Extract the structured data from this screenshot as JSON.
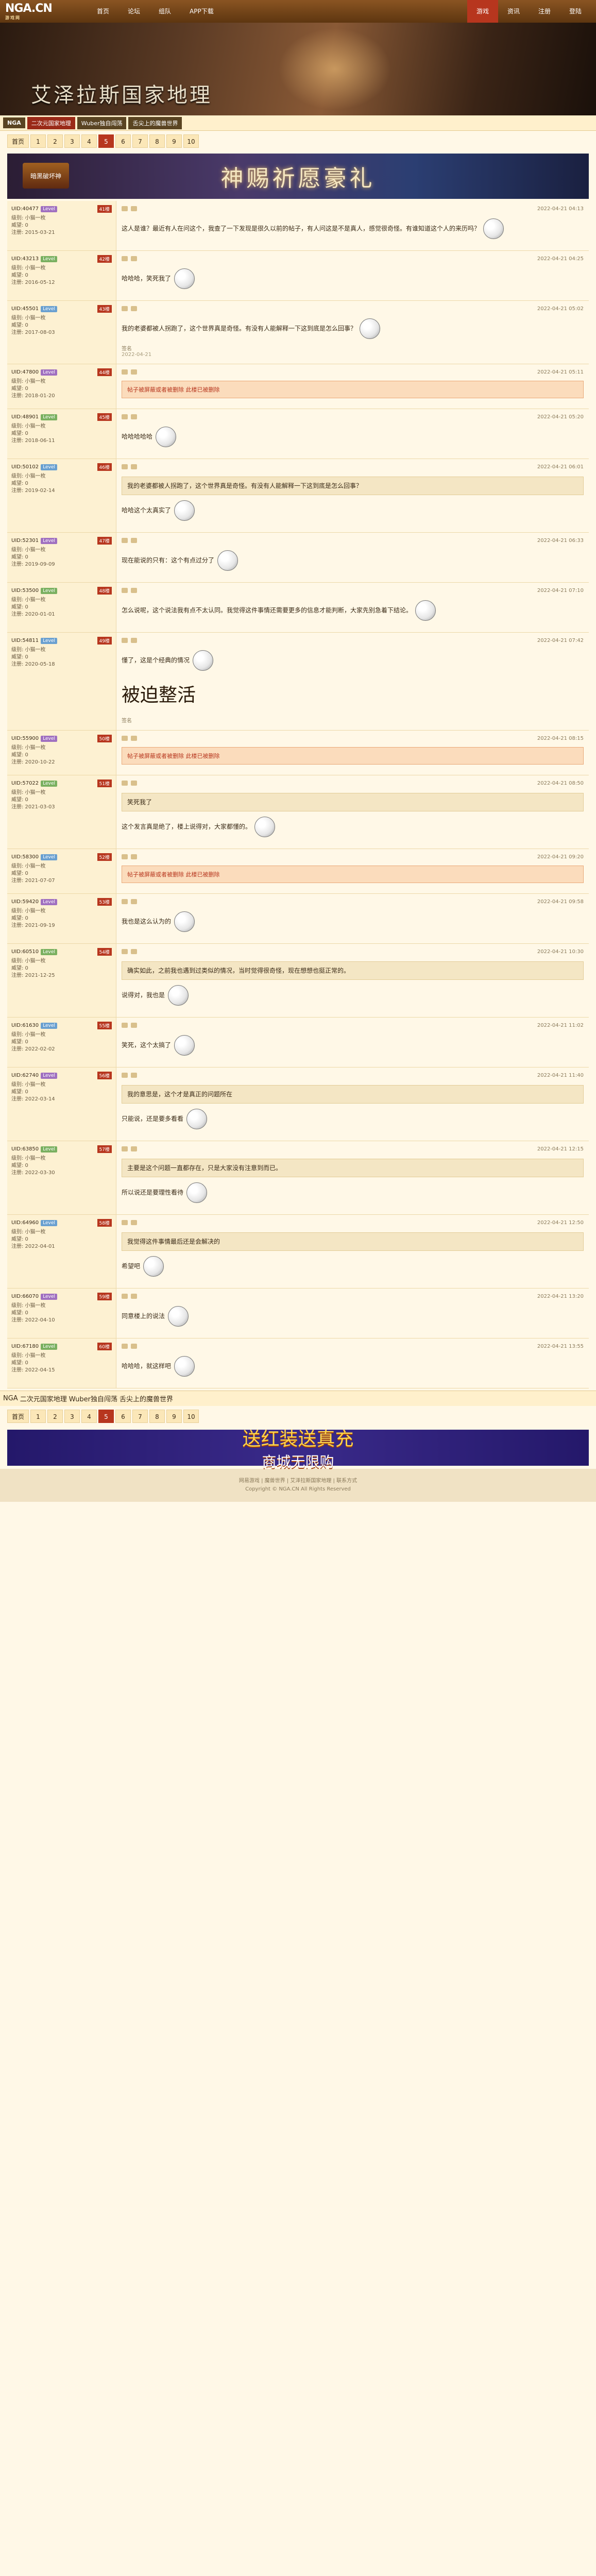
{
  "logo": {
    "main": "NGA.CN",
    "sub": "游戏网"
  },
  "nav": [
    "首页",
    "论坛",
    "组队",
    "APP下载"
  ],
  "nav_right": [
    "游戏",
    "资讯",
    "注册",
    "登陆"
  ],
  "banner_title": "艾泽拉斯国家地理",
  "subnav": {
    "home": "NGA",
    "tags": [
      "二次元国家地理",
      "Wuber独自闯荡",
      "舌尖上的魔兽世界"
    ],
    "home_btn": "论坛"
  },
  "pager": {
    "first": "首页",
    "pages": [
      "1",
      "2",
      "3",
      "4",
      "5",
      "6",
      "7",
      "8",
      "9",
      "10"
    ],
    "current": "5"
  },
  "ad_top": "神赐祈愿豪礼",
  "ad_logo": "暗黑破坏神",
  "posts": [
    {
      "uid": "UID:40477",
      "badge": "Level",
      "meta": [
        "级别: 小猫一枚",
        "威望: 0",
        "注册: 2015-03-21"
      ],
      "floor": "41楼",
      "time": "2022-04-21 04:13",
      "body": "这人是谁？最近有人在问这个，我查了一下发现是很久以前的帖子，有人问这是不是真人，感觉很奇怪。有谁知道这个人的来历吗？"
    },
    {
      "uid": "UID:43213",
      "badge": "Level",
      "meta": [
        "级别: 小猫一枚",
        "威望: 0",
        "注册: 2016-05-12"
      ],
      "floor": "42楼",
      "time": "2022-04-21 04:25",
      "body": "哈哈哈，笑死我了"
    },
    {
      "uid": "UID:45501",
      "badge": "Level",
      "meta": [
        "级别: 小猫一枚",
        "威望: 0",
        "注册: 2017-08-03"
      ],
      "floor": "43楼",
      "time": "2022-04-21 05:02",
      "body": "我的老婆都被人拐跑了，这个世界真是奇怪。有没有人能解释一下这到底是怎么回事？",
      "sig": "签名",
      "sig_time": "2022-04-21"
    },
    {
      "uid": "UID:47800",
      "badge": "Level",
      "meta": [
        "级别: 小猫一枚",
        "威望: 0",
        "注册: 2018-01-20"
      ],
      "floor": "44楼",
      "time": "2022-04-21 05:11",
      "red": "帖子被屏蔽或者被删除 此楼已被删除"
    },
    {
      "uid": "UID:48901",
      "badge": "Level",
      "meta": [
        "级别: 小猫一枚",
        "威望: 0",
        "注册: 2018-06-11"
      ],
      "floor": "45楼",
      "time": "2022-04-21 05:20",
      "body": "哈哈哈哈哈"
    },
    {
      "uid": "UID:50102",
      "badge": "Level",
      "meta": [
        "级别: 小猫一枚",
        "威望: 0",
        "注册: 2019-02-14"
      ],
      "floor": "46楼",
      "time": "2022-04-21 06:01",
      "quote": "我的老婆都被人拐跑了，这个世界真是奇怪。有没有人能解释一下这到底是怎么回事？",
      "body": "哈哈这个太真实了"
    },
    {
      "uid": "UID:52301",
      "badge": "Level",
      "meta": [
        "级别: 小猫一枚",
        "威望: 0",
        "注册: 2019-09-09"
      ],
      "floor": "47楼",
      "time": "2022-04-21 06:33",
      "body": "现在能说的只有：这个有点过分了"
    },
    {
      "uid": "UID:53500",
      "badge": "Level",
      "meta": [
        "级别: 小猫一枚",
        "威望: 0",
        "注册: 2020-01-01"
      ],
      "floor": "48楼",
      "time": "2022-04-21 07:10",
      "body": "怎么说呢，这个说法我有点不太认同。我觉得这件事情还需要更多的信息才能判断，大家先别急着下结论。"
    },
    {
      "uid": "UID:54811",
      "badge": "Level",
      "meta": [
        "级别: 小猫一枚",
        "威望: 0",
        "注册: 2020-05-18"
      ],
      "floor": "49楼",
      "time": "2022-04-21 07:42",
      "body": "懂了，这是个经典的情况",
      "big": "被迫整活",
      "sig": "签名"
    },
    {
      "uid": "UID:55900",
      "badge": "Level",
      "meta": [
        "级别: 小猫一枚",
        "威望: 0",
        "注册: 2020-10-22"
      ],
      "floor": "50楼",
      "time": "2022-04-21 08:15",
      "red": "帖子被屏蔽或者被删除 此楼已被删除"
    },
    {
      "uid": "UID:57022",
      "badge": "Level",
      "meta": [
        "级别: 小猫一枚",
        "威望: 0",
        "注册: 2021-03-03"
      ],
      "floor": "51楼",
      "time": "2022-04-21 08:50",
      "quote": "笑死我了",
      "body": "这个发言真是绝了，楼上说得对，大家都懂的。"
    },
    {
      "uid": "UID:58300",
      "badge": "Level",
      "meta": [
        "级别: 小猫一枚",
        "威望: 0",
        "注册: 2021-07-07"
      ],
      "floor": "52楼",
      "time": "2022-04-21 09:20",
      "red": "帖子被屏蔽或者被删除 此楼已被删除"
    },
    {
      "uid": "UID:59420",
      "badge": "Level",
      "meta": [
        "级别: 小猫一枚",
        "威望: 0",
        "注册: 2021-09-19"
      ],
      "floor": "53楼",
      "time": "2022-04-21 09:58",
      "body": "我也是这么认为的"
    },
    {
      "uid": "UID:60510",
      "badge": "Level",
      "meta": [
        "级别: 小猫一枚",
        "威望: 0",
        "注册: 2021-12-25"
      ],
      "floor": "54楼",
      "time": "2022-04-21 10:30",
      "quote": "确实如此，之前我也遇到过类似的情况，当时觉得很奇怪，现在想想也挺正常的。",
      "body": "说得对，我也是"
    },
    {
      "uid": "UID:61630",
      "badge": "Level",
      "meta": [
        "级别: 小猫一枚",
        "威望: 0",
        "注册: 2022-02-02"
      ],
      "floor": "55楼",
      "time": "2022-04-21 11:02",
      "body": "笑死，这个太搞了"
    },
    {
      "uid": "UID:62740",
      "badge": "Level",
      "meta": [
        "级别: 小猫一枚",
        "威望: 0",
        "注册: 2022-03-14"
      ],
      "floor": "56楼",
      "time": "2022-04-21 11:40",
      "quote": "我的意思是，这个才是真正的问题所在",
      "body": "只能说，还是要多看看"
    },
    {
      "uid": "UID:63850",
      "badge": "Level",
      "meta": [
        "级别: 小猫一枚",
        "威望: 0",
        "注册: 2022-03-30"
      ],
      "floor": "57楼",
      "time": "2022-04-21 12:15",
      "quote": "主要是这个问题一直都存在，只是大家没有注意到而已。",
      "body": "所以说还是要理性看待"
    },
    {
      "uid": "UID:64960",
      "badge": "Level",
      "meta": [
        "级别: 小猫一枚",
        "威望: 0",
        "注册: 2022-04-01"
      ],
      "floor": "58楼",
      "time": "2022-04-21 12:50",
      "quote": "我觉得这件事情最后还是会解决的",
      "body": "希望吧"
    },
    {
      "uid": "UID:66070",
      "badge": "Level",
      "meta": [
        "级别: 小猫一枚",
        "威望: 0",
        "注册: 2022-04-10"
      ],
      "floor": "59楼",
      "time": "2022-04-21 13:20",
      "body": "同意楼上的说法"
    },
    {
      "uid": "UID:67180",
      "badge": "Level",
      "meta": [
        "级别: 小猫一枚",
        "威望: 0",
        "注册: 2022-04-15"
      ],
      "floor": "60楼",
      "time": "2022-04-21 13:55",
      "body": "哈哈哈，就这样吧"
    }
  ],
  "ad_bottom": {
    "l1": "送红装送真充",
    "l2": "商城无限购"
  },
  "footer": [
    "网易游戏 | 魔兽世界 | 艾泽拉斯国家地理 | 联系方式",
    "Copyright © NGA.CN All Rights Reserved"
  ]
}
